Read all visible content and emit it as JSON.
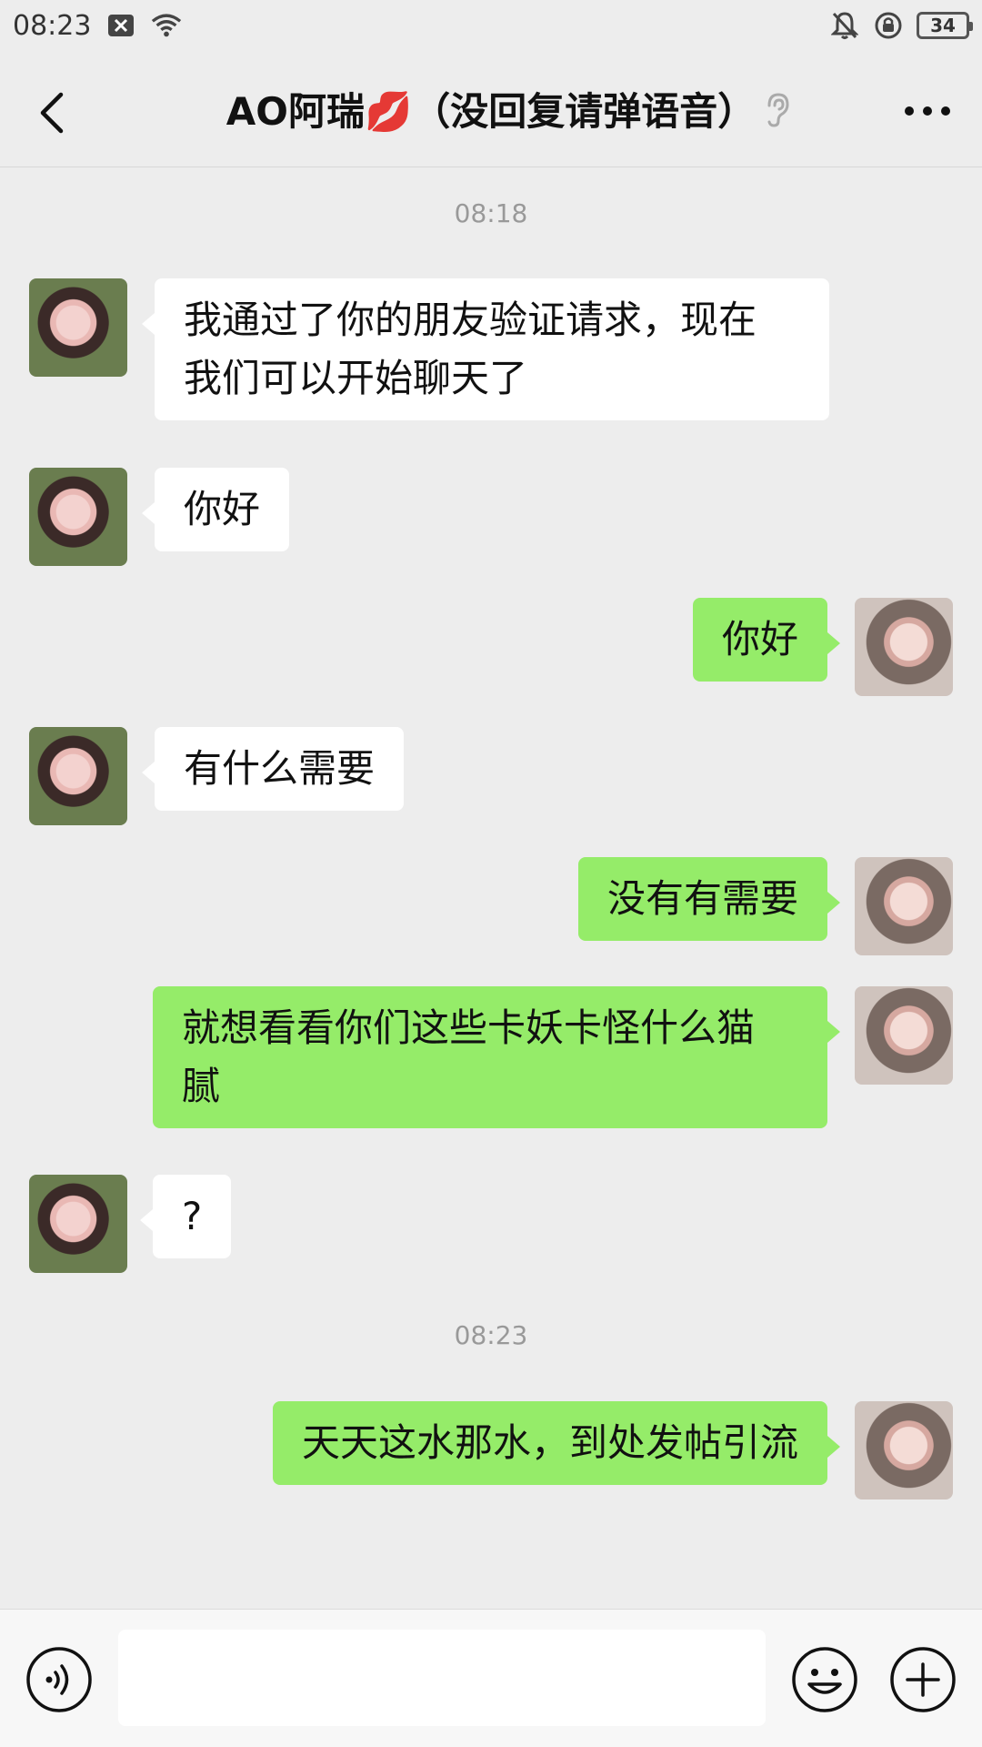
{
  "status_bar": {
    "time": "08:23",
    "battery": "34"
  },
  "header": {
    "title": "AO阿瑞💋（没回复请弹语音）"
  },
  "chat": {
    "timestamps": [
      "08:18",
      "08:23"
    ],
    "messages": [
      {
        "side": "in",
        "text_lines": [
          "我通过了你的朋友验证请求，现在",
          "我们可以开始聊天了"
        ]
      },
      {
        "side": "in",
        "text_lines": [
          "你好"
        ]
      },
      {
        "side": "out",
        "text_lines": [
          "你好"
        ]
      },
      {
        "side": "in",
        "text_lines": [
          "有什么需要"
        ]
      },
      {
        "side": "out",
        "text_lines": [
          "没有有需要"
        ]
      },
      {
        "side": "out",
        "text_lines": [
          "就想看看你们这些卡妖卡怪什么猫",
          "腻"
        ]
      },
      {
        "side": "in",
        "text_lines": [
          "?"
        ]
      },
      {
        "side": "out",
        "text_lines": [
          "天天这水那水，到处发帖引流"
        ]
      }
    ]
  },
  "input": {
    "value": ""
  },
  "icons": {
    "back": "back-arrow-icon",
    "ear": "ear-icon",
    "more": "more-dots-icon",
    "voice": "voice-icon",
    "emoji": "emoji-icon",
    "plus": "plus-icon"
  },
  "colors": {
    "background": "#ededed",
    "bubble_out": "#95ec69",
    "bubble_in": "#ffffff"
  }
}
